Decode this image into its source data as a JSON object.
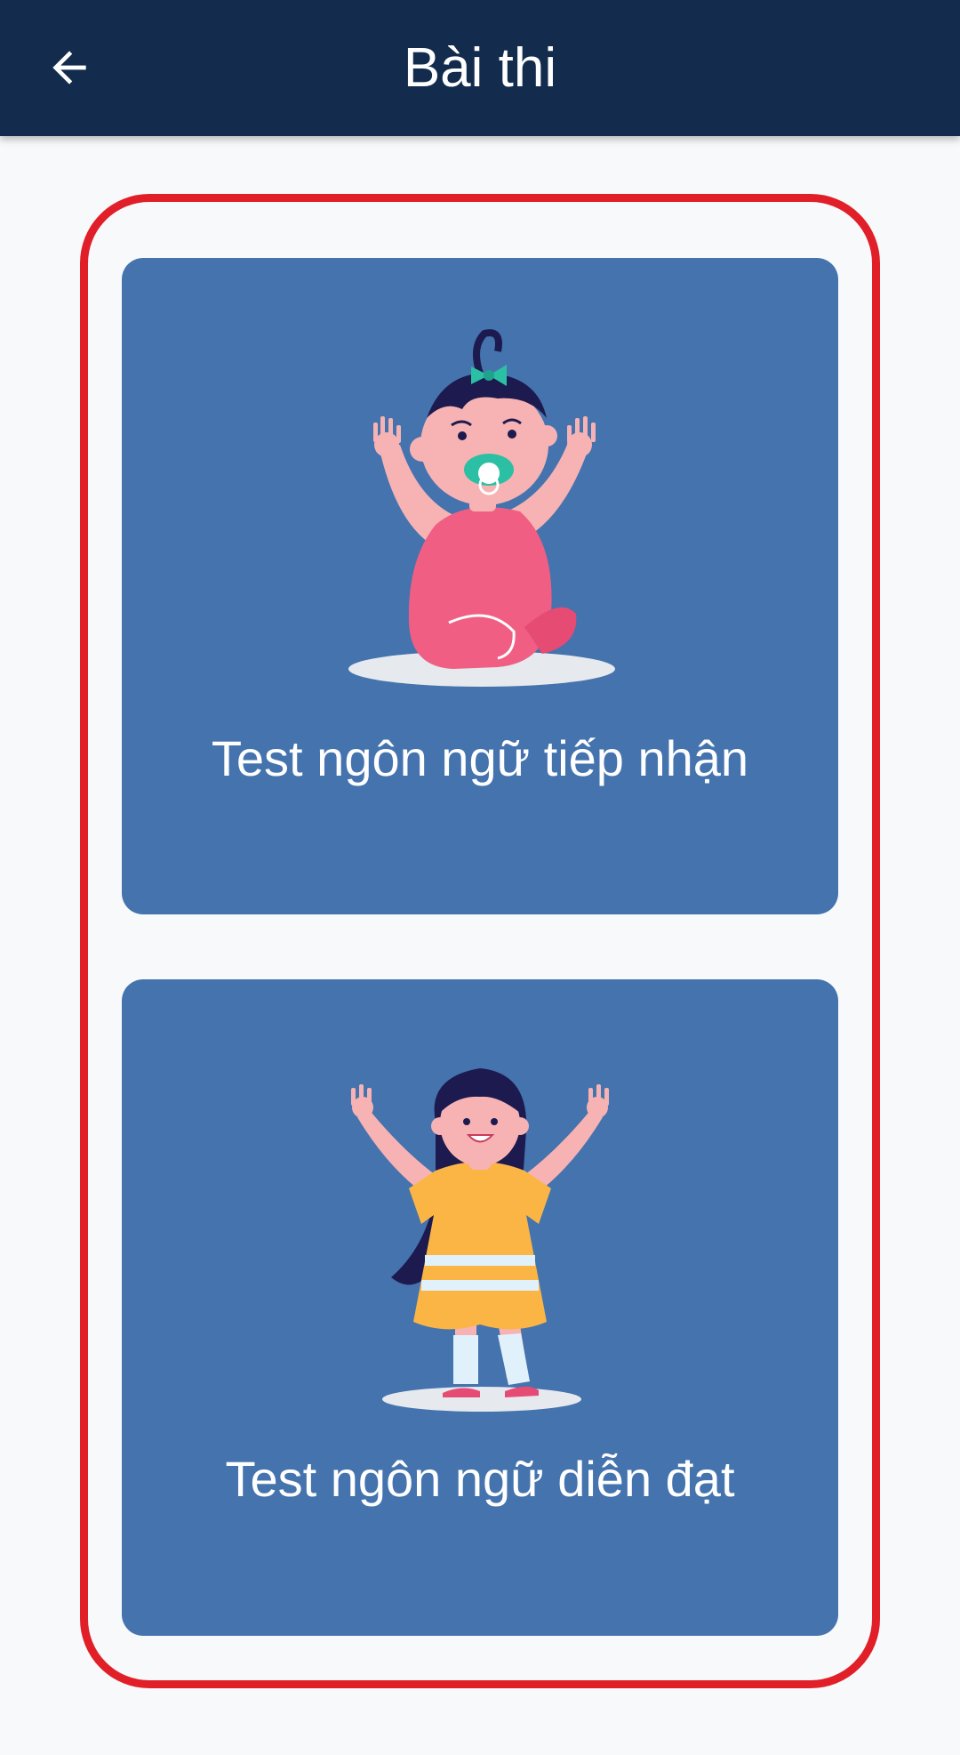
{
  "header": {
    "title": "Bài thi",
    "back_icon": "arrow-left-icon"
  },
  "colors": {
    "header_bg": "#132c4e",
    "card_bg": "#4473ae",
    "highlight_border": "#e11f28",
    "page_bg": "#f8f9fb"
  },
  "tests": [
    {
      "label": "Test ngôn ngữ tiếp nhận",
      "illustration": "baby-with-pacifier-illustration"
    },
    {
      "label": "Test ngôn ngữ diễn đạt",
      "illustration": "girl-waving-illustration"
    }
  ]
}
